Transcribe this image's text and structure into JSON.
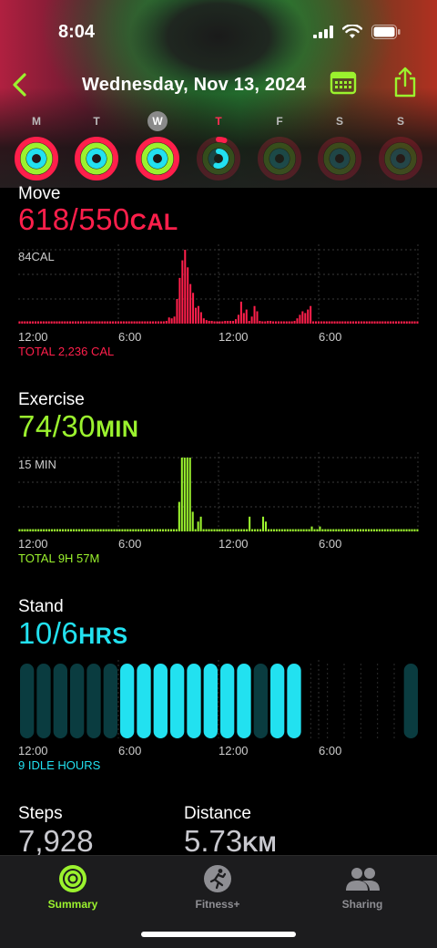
{
  "status": {
    "time": "8:04"
  },
  "nav": {
    "title": "Wednesday, Nov 13, 2024"
  },
  "colors": {
    "move": "#ff1f4b",
    "exercise": "#9bf22e",
    "stand": "#22e1f0",
    "accent": "#9bf22e"
  },
  "week": [
    {
      "letter": "M",
      "state": "normal",
      "move": 1.0,
      "exercise": 1.0,
      "stand": 1.0
    },
    {
      "letter": "T",
      "state": "normal",
      "move": 1.0,
      "exercise": 1.0,
      "stand": 1.0
    },
    {
      "letter": "W",
      "state": "selected",
      "move": 1.0,
      "exercise": 1.0,
      "stand": 1.0
    },
    {
      "letter": "T",
      "state": "today",
      "move": 0.05,
      "exercise": 0.0,
      "stand": 0.55
    },
    {
      "letter": "F",
      "state": "normal",
      "move": 0,
      "exercise": 0,
      "stand": 0
    },
    {
      "letter": "S",
      "state": "normal",
      "move": 0,
      "exercise": 0,
      "stand": 0
    },
    {
      "letter": "S",
      "state": "normal",
      "move": 0,
      "exercise": 0,
      "stand": 0
    }
  ],
  "move": {
    "label": "Move",
    "value": "618/550",
    "unit": "CAL",
    "max_label": "84CAL",
    "total": "TOTAL 2,236 CAL",
    "bars": [
      0,
      0,
      0,
      0,
      0,
      0,
      0,
      0,
      0,
      0,
      0,
      0,
      0,
      0,
      0,
      0,
      0,
      0,
      0,
      0,
      0,
      0,
      0,
      0,
      0,
      0,
      0,
      0,
      0,
      0,
      0,
      0,
      0,
      0,
      0,
      0,
      0,
      0,
      0,
      0,
      0,
      0,
      0,
      0,
      0,
      0,
      0,
      0,
      0,
      0,
      0,
      0,
      0,
      0,
      0,
      3,
      7,
      6,
      8,
      28,
      52,
      72,
      84,
      64,
      45,
      35,
      18,
      20,
      13,
      6,
      4,
      3,
      2,
      0,
      0,
      0,
      0,
      2,
      3,
      3,
      2,
      5,
      10,
      25,
      12,
      16,
      2,
      8,
      20,
      14,
      2,
      0,
      0,
      2,
      2,
      0,
      0,
      0,
      0,
      0,
      0,
      0,
      0,
      3,
      6,
      10,
      14,
      12,
      16,
      20,
      0,
      0,
      0,
      0,
      0,
      0,
      0,
      0,
      0,
      0,
      0,
      0,
      0,
      0,
      0,
      0,
      0,
      0,
      0,
      0,
      0,
      0,
      0,
      0,
      0,
      0,
      0,
      0,
      0,
      0,
      0,
      0,
      0,
      0,
      0,
      0,
      0,
      0,
      0,
      0
    ]
  },
  "exercise": {
    "label": "Exercise",
    "value": "74/30",
    "unit": "MIN",
    "max_label": "15 MIN",
    "total": "TOTAL 9H 57M",
    "bars": [
      0,
      0,
      0,
      0,
      0,
      0,
      0,
      0,
      0,
      0,
      0,
      0,
      0,
      0,
      0,
      0,
      0,
      0,
      0,
      0,
      0,
      0,
      0,
      0,
      0,
      0,
      0,
      0,
      0,
      0,
      0,
      0,
      0,
      0,
      0,
      0,
      0,
      0,
      0,
      0,
      0,
      0,
      0,
      0,
      0,
      0,
      0,
      0,
      0,
      0,
      0,
      0,
      0,
      0,
      0,
      0,
      0,
      0,
      0,
      6,
      15,
      15,
      15,
      15,
      4,
      0,
      2,
      3,
      0,
      0,
      0,
      0,
      0,
      0,
      0,
      0,
      0,
      0,
      0,
      0,
      0,
      0,
      0,
      0,
      0,
      3,
      0,
      0,
      0,
      0,
      3,
      2,
      0,
      0,
      0,
      0,
      0,
      0,
      0,
      0,
      0,
      0,
      0,
      0,
      0,
      0,
      0,
      0,
      1,
      0,
      0,
      1,
      0,
      0,
      0,
      0,
      0,
      0,
      0,
      0,
      0,
      0,
      0,
      0,
      0,
      0,
      0,
      0,
      0,
      0,
      0,
      0,
      0,
      0,
      0,
      0,
      0,
      0,
      0,
      0,
      0,
      0,
      0,
      0,
      0,
      0,
      0,
      0
    ]
  },
  "stand": {
    "label": "Stand",
    "value": "10/6",
    "unit": "HRS",
    "idle": "9 IDLE HOURS",
    "hours": [
      1,
      1,
      1,
      1,
      1,
      1,
      2,
      2,
      2,
      2,
      2,
      2,
      2,
      2,
      1,
      2,
      2,
      0,
      0,
      0,
      0,
      0,
      0,
      1,
      2,
      1
    ]
  },
  "axis": {
    "t0": "12:00",
    "t1": "6:00",
    "t2": "12:00",
    "t3": "6:00"
  },
  "steps": {
    "label": "Steps",
    "value": "7,928"
  },
  "distance": {
    "label": "Distance",
    "value": "5.73",
    "unit": "KM"
  },
  "tabs": [
    {
      "label": "Summary",
      "icon": "summary-rings-icon",
      "active": true
    },
    {
      "label": "Fitness+",
      "icon": "fitness-plus-icon",
      "active": false
    },
    {
      "label": "Sharing",
      "icon": "sharing-people-icon",
      "active": false
    }
  ]
}
